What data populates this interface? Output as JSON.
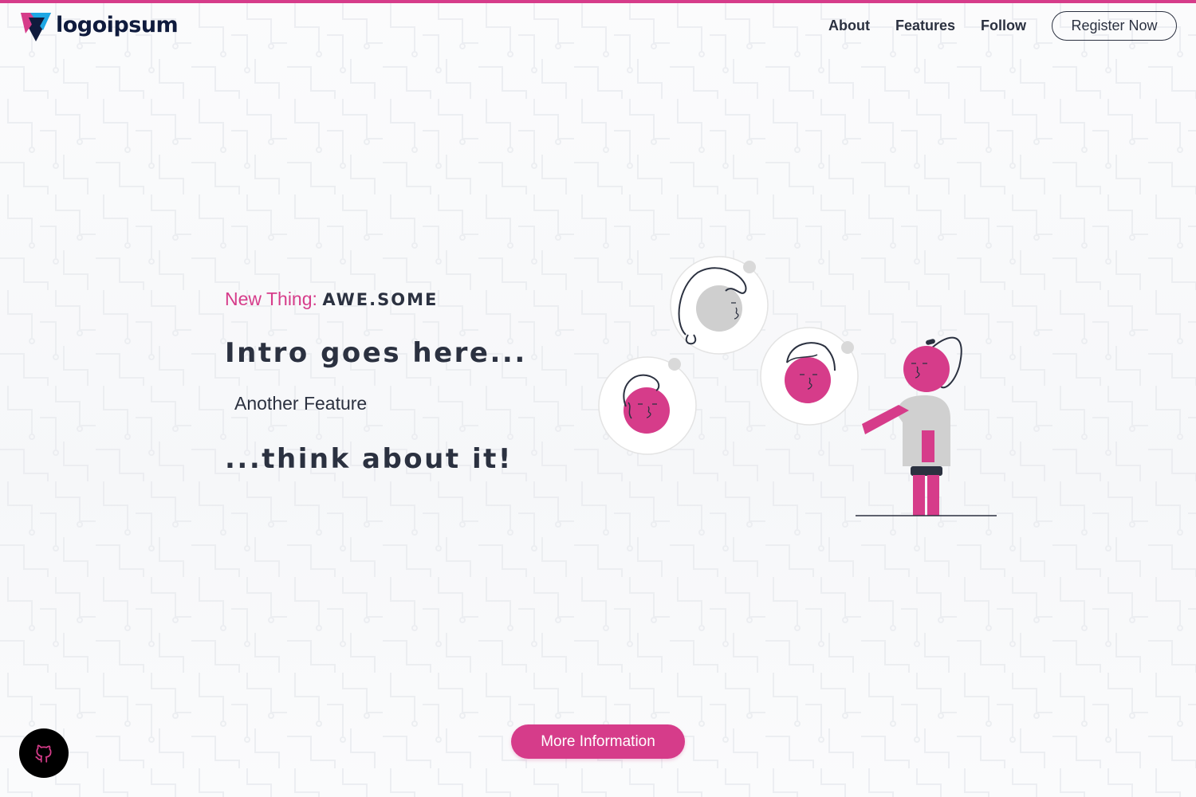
{
  "brand": {
    "name": "logoipsum",
    "accent": "#d63c8a",
    "dark": "#2b3140"
  },
  "nav": {
    "links": [
      {
        "label": "About"
      },
      {
        "label": "Features"
      },
      {
        "label": "Follow"
      }
    ],
    "register_label": "Register Now"
  },
  "hero": {
    "eyebrow_prefix": "New Thing:",
    "eyebrow_strong": "AWE.SOME",
    "intro": "Intro goes here...",
    "feature": "Another Feature",
    "outro": "...think about it!"
  },
  "cta": {
    "more_label": "More Information"
  },
  "icons": {
    "github": "github-icon",
    "logo": "logo-mark-icon"
  }
}
